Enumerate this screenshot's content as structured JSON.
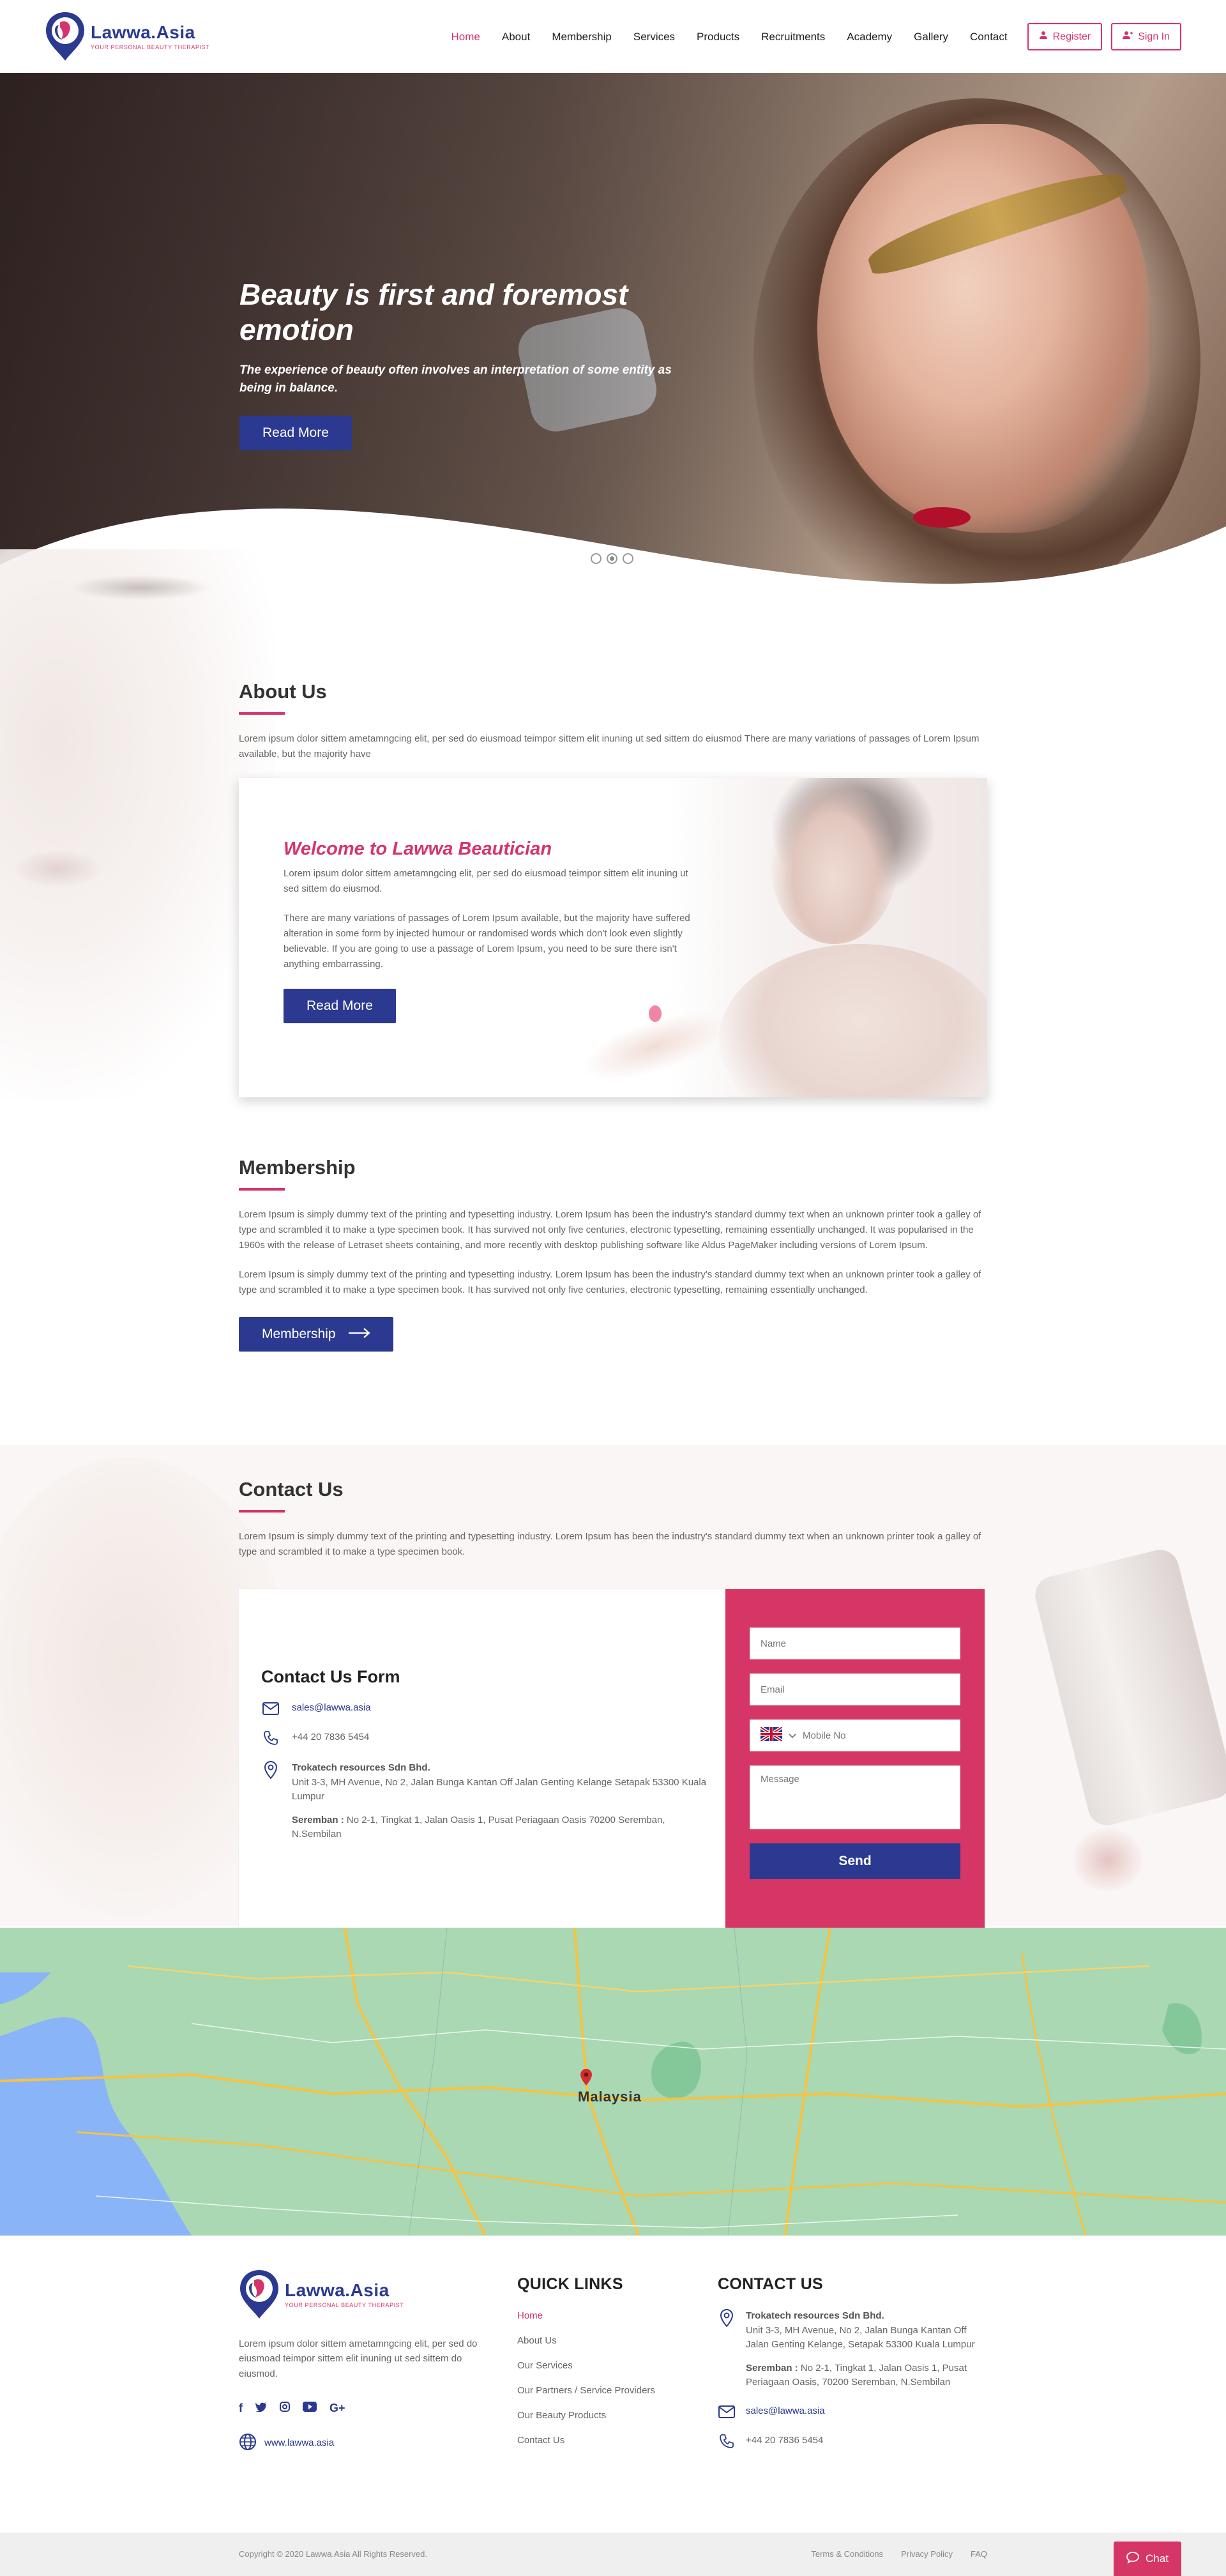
{
  "brand": {
    "name": "Lawwa.Asia",
    "tagline": "YOUR PERSONAL BEAUTY THERAPIST",
    "primary_color": "#2b3990",
    "accent_color": "#d6336c"
  },
  "nav": {
    "items": [
      {
        "label": "Home",
        "active": true
      },
      {
        "label": "About"
      },
      {
        "label": "Membership"
      },
      {
        "label": "Services"
      },
      {
        "label": "Products"
      },
      {
        "label": "Recruitments"
      },
      {
        "label": "Academy"
      },
      {
        "label": "Gallery"
      },
      {
        "label": "Contact"
      }
    ],
    "register_label": "Register",
    "signin_label": "Sign In"
  },
  "hero": {
    "title": "Beauty is first and foremost emotion",
    "subtitle": "The experience of beauty often involves an interpretation of some entity as being in balance.",
    "button_label": "Read More",
    "slides": 3,
    "active_slide": 2
  },
  "about": {
    "title": "About Us",
    "text": "Lorem ipsum dolor sittem ametamngcing elit, per sed do eiusmoad teimpor sittem elit inuning ut sed sittem do eiusmod There are many variations of passages of Lorem Ipsum available, but the majority have"
  },
  "welcome": {
    "title": "Welcome to Lawwa Beautician",
    "text1": "Lorem ipsum dolor sittem ametamngcing elit, per sed do eiusmoad teimpor sittem elit inuning ut sed sittem do eiusmod.",
    "text2": "There are many variations of passages of Lorem Ipsum available, but the majority have suffered alteration in some form by injected humour or randomised words which don't look even slightly believable. If you are going to use a passage of Lorem Ipsum, you need to be sure there isn't anything embarrassing.",
    "button_label": "Read More"
  },
  "membership": {
    "title": "Membership",
    "text1": "Lorem Ipsum is simply dummy text of the printing and typesetting industry. Lorem Ipsum has been the industry's standard dummy text  when an unknown printer took a galley of type and scrambled it to make a type specimen book. It has survived not only five centuries, electronic typesetting, remaining essentially unchanged. It was popularised in the 1960s with the release of Letraset sheets containing, and more recently with desktop publishing software like Aldus PageMaker including versions of Lorem Ipsum.",
    "text2": "Lorem Ipsum is simply dummy text of the printing and typesetting industry. Lorem Ipsum has been the industry's standard dummy text  when an unknown printer took a galley of type and scrambled it to make a type specimen book. It has survived not only five centuries,  electronic typesetting, remaining essentially unchanged.",
    "button_label": "Membership"
  },
  "contact": {
    "title": "Contact Us",
    "text": "Lorem Ipsum is simply dummy text of the printing and typesetting industry. Lorem Ipsum has been the industry's standard dummy text  when an unknown printer took a galley of type and scrambled it to make a type specimen book.",
    "form_title": "Contact Us Form",
    "email": "sales@lawwa.asia",
    "phone": "+44 20 7836 5454",
    "company": "Trokatech resources Sdn Bhd.",
    "address": "Unit 3-3, MH Avenue, No 2, Jalan Bunga Kantan Off Jalan Genting Kelange Setapak 53300 Kuala Lumpur",
    "seremban_label": "Seremban :",
    "seremban_address": "No 2-1, Tingkat 1, Jalan Oasis 1, Pusat Periagaan Oasis 70200 Seremban, N.Sembilan",
    "form": {
      "name_placeholder": "Name",
      "email_placeholder": "Email",
      "mobile_placeholder": "Mobile No",
      "message_placeholder": "Message",
      "send_label": "Send"
    }
  },
  "map": {
    "label": "Malaysia"
  },
  "footer": {
    "about": "Lorem ipsum dolor sittem ametamngcing elit, per sed do eiusmoad teimpor sittem elit inuning ut sed sittem do eiusmod.",
    "website": "www.lawwa.asia",
    "quick_links_title": "QUICK LINKS",
    "links": [
      "Home",
      "About Us",
      "Our Services",
      "Our Partners / Service Providers",
      "Our Beauty Products",
      "Contact Us"
    ],
    "contact_title": "CONTACT US",
    "company": "Trokatech resources Sdn Bhd.",
    "address": "Unit 3-3, MH Avenue, No 2, Jalan Bunga Kantan Off Jalan Genting Kelange, Setapak 53300 Kuala Lumpur",
    "seremban_label": "Seremban :",
    "seremban_address": "No 2-1, Tingkat 1, Jalan Oasis 1, Pusat Periagaan Oasis, 70200 Seremban, N.Sembilan",
    "email": "sales@lawwa.asia",
    "phone": "+44 20 7836 5454"
  },
  "bottom": {
    "copyright": "Copyright © 2020 Lawwa.Asia All Rights Reserved.",
    "terms": "Terms & Conditions",
    "privacy": "Privacy Policy",
    "faq": "FAQ",
    "chat_label": "Chat"
  }
}
